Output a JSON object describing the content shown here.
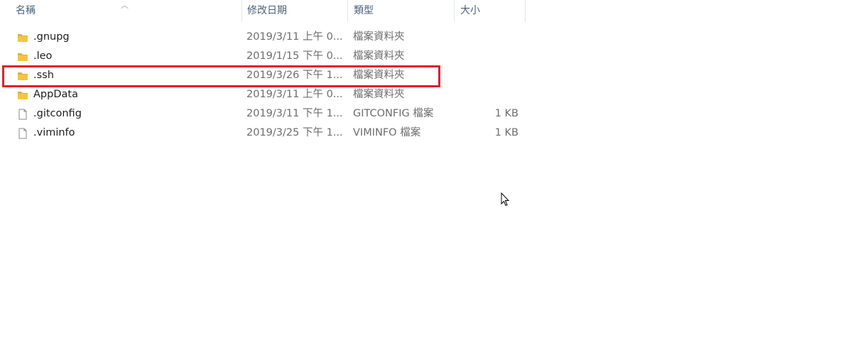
{
  "columns": {
    "name": "名稱",
    "modified": "修改日期",
    "type": "類型",
    "size": "大小"
  },
  "files": [
    {
      "name": ".gnupg",
      "modified": "2019/3/11 上午 0...",
      "type": "檔案資料夾",
      "size": "",
      "icon": "folder-icon"
    },
    {
      "name": ".leo",
      "modified": "2019/1/15 下午 0...",
      "type": "檔案資料夾",
      "size": "",
      "icon": "folder-icon"
    },
    {
      "name": ".ssh",
      "modified": "2019/3/26 下午 1...",
      "type": "檔案資料夾",
      "size": "",
      "icon": "folder-icon",
      "highlighted": true
    },
    {
      "name": "AppData",
      "modified": "2019/3/11 上午 0...",
      "type": "檔案資料夾",
      "size": "",
      "icon": "folder-icon"
    },
    {
      "name": ".gitconfig",
      "modified": "2019/3/11 下午 1...",
      "type": "GITCONFIG 檔案",
      "size": "1 KB",
      "icon": "file-icon"
    },
    {
      "name": ".viminfo",
      "modified": "2019/3/25 下午 1...",
      "type": "VIMINFO 檔案",
      "size": "1 KB",
      "icon": "file-icon"
    }
  ],
  "colors": {
    "highlight_border": "#e0202b",
    "folder": "#f5c542"
  }
}
